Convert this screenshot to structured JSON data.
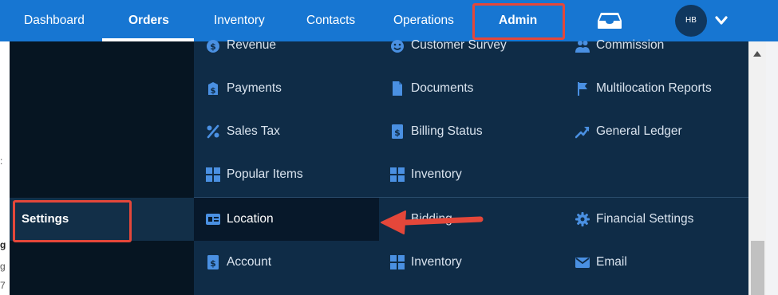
{
  "topnav": {
    "items": [
      {
        "label": "Dashboard"
      },
      {
        "label": "Orders"
      },
      {
        "label": "Inventory"
      },
      {
        "label": "Contacts"
      },
      {
        "label": "Operations"
      },
      {
        "label": "Admin"
      }
    ],
    "active_item": "Orders",
    "highlighted_item": "Admin",
    "inbox_icon": "inbox-icon",
    "avatar_initials": "HB",
    "chevron_icon": "chevron-down-icon"
  },
  "sidebar": {
    "settings_label": "Settings"
  },
  "menu": {
    "col1": [
      {
        "label": "Revenue",
        "icon": "revenue-icon"
      },
      {
        "label": "Payments",
        "icon": "payments-icon"
      },
      {
        "label": "Sales Tax",
        "icon": "percent-icon"
      },
      {
        "label": "Popular Items",
        "icon": "grid-icon"
      },
      {
        "label": "Location",
        "icon": "id-card-icon"
      },
      {
        "label": "Account",
        "icon": "account-icon"
      }
    ],
    "col2": [
      {
        "label": "Customer Survey",
        "icon": "smiley-icon"
      },
      {
        "label": "Documents",
        "icon": "document-icon"
      },
      {
        "label": "Billing Status",
        "icon": "billing-icon"
      },
      {
        "label": "Inventory",
        "icon": "grid-icon"
      },
      {
        "label": "Bidding",
        "icon": "bidding-icon"
      },
      {
        "label": "Inventory",
        "icon": "grid-icon"
      }
    ],
    "col3": [
      {
        "label": "Commission",
        "icon": "people-icon"
      },
      {
        "label": "Multilocation Reports",
        "icon": "flag-icon"
      },
      {
        "label": "General Ledger",
        "icon": "trend-up-icon"
      },
      {
        "label": "Financial Settings",
        "icon": "gear-icon"
      },
      {
        "label": "Email",
        "icon": "envelope-icon"
      }
    ]
  },
  "colors": {
    "nav_blue": "#1776d2",
    "menu_bg": "#0f2c47",
    "sidebar_bg": "#061522",
    "annotation_red": "#e4473a",
    "icon_blue": "#4a90e2"
  }
}
